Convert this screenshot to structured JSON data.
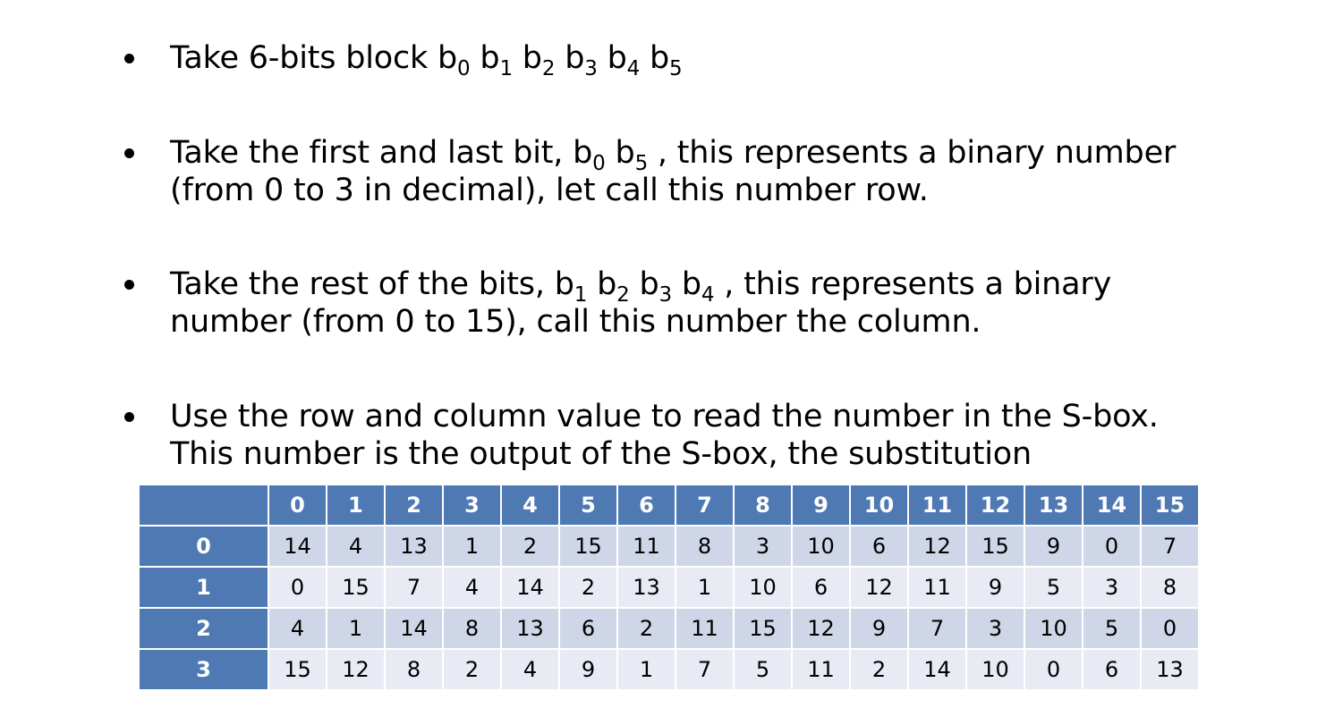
{
  "bullets": [
    {
      "lines": [
        [
          {
            "t": "Take 6-bits block b"
          },
          {
            "s": "0"
          },
          {
            "t": " b"
          },
          {
            "s": "1"
          },
          {
            "t": " b"
          },
          {
            "s": "2"
          },
          {
            "t": " b"
          },
          {
            "s": "3"
          },
          {
            "t": " b"
          },
          {
            "s": "4"
          },
          {
            "t": " b"
          },
          {
            "s": "5"
          }
        ]
      ]
    },
    {
      "lines": [
        [
          {
            "t": "Take the first and last bit, b"
          },
          {
            "s": "0"
          },
          {
            "t": " b"
          },
          {
            "s": "5"
          },
          {
            "t": " , this represents a binary number"
          }
        ],
        [
          {
            "t": "(from 0 to 3 in decimal), let call this number row."
          }
        ]
      ]
    },
    {
      "lines": [
        [
          {
            "t": "Take the rest of the bits, b"
          },
          {
            "s": "1"
          },
          {
            "t": " b"
          },
          {
            "s": "2"
          },
          {
            "t": " b"
          },
          {
            "s": "3"
          },
          {
            "t": " b"
          },
          {
            "s": "4"
          },
          {
            "t": " , this represents a binary"
          }
        ],
        [
          {
            "t": "number (from 0 to 15), call this number the column."
          }
        ]
      ]
    },
    {
      "lines": [
        [
          {
            "t": " Use the row and column value to read the number in the S-box."
          }
        ],
        [
          {
            "t": "This number is the output of the S-box, the substitution"
          }
        ]
      ]
    }
  ],
  "sbox": {
    "corner": "",
    "columns": [
      "0",
      "1",
      "2",
      "3",
      "4",
      "5",
      "6",
      "7",
      "8",
      "9",
      "10",
      "11",
      "12",
      "13",
      "14",
      "15"
    ],
    "rows": [
      {
        "label": "0",
        "values": [
          "14",
          "4",
          "13",
          "1",
          "2",
          "15",
          "11",
          "8",
          "3",
          "10",
          "6",
          "12",
          "15",
          "9",
          "0",
          "7"
        ]
      },
      {
        "label": "1",
        "values": [
          "0",
          "15",
          "7",
          "4",
          "14",
          "2",
          "13",
          "1",
          "10",
          "6",
          "12",
          "11",
          "9",
          "5",
          "3",
          "8"
        ]
      },
      {
        "label": "2",
        "values": [
          "4",
          "1",
          "14",
          "8",
          "13",
          "6",
          "2",
          "11",
          "15",
          "12",
          "9",
          "7",
          "3",
          "10",
          "5",
          "0"
        ]
      },
      {
        "label": "3",
        "values": [
          "15",
          "12",
          "8",
          "2",
          "4",
          "9",
          "1",
          "7",
          "5",
          "11",
          "2",
          "14",
          "10",
          "0",
          "6",
          "13"
        ]
      }
    ]
  },
  "colors": {
    "header_blue": "#4f79b3",
    "row_dark": "#cfd6e7",
    "row_light": "#e8ebf4"
  }
}
